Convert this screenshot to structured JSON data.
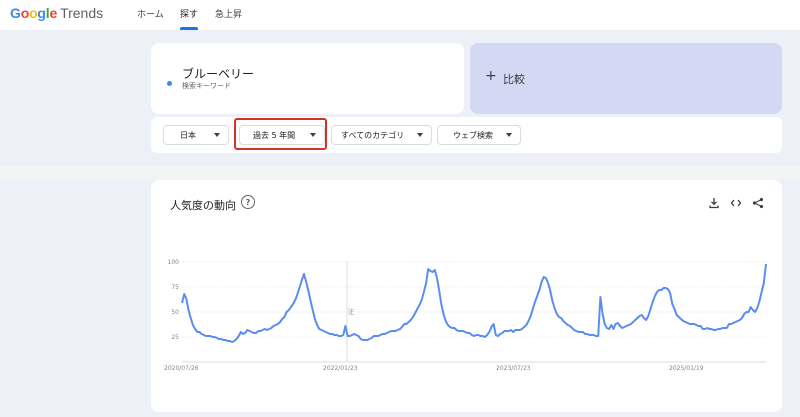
{
  "header": {
    "logo_google": "Google",
    "logo_trends": "Trends",
    "nav": [
      "ホーム",
      "探す",
      "急上昇"
    ],
    "active_nav": "探す"
  },
  "search": {
    "term": "ブルーベリー",
    "term_sublabel": "検索キーワード",
    "term_color": "#4285f4",
    "compare_label": "比較"
  },
  "filters": {
    "region": "日本",
    "period": "過去 5 年間",
    "category": "すべてのカテゴリ",
    "search_type": "ウェブ検索"
  },
  "chart_card": {
    "title": "人気度の動向",
    "help_icon": "help-icon",
    "actions": [
      "download-icon",
      "embed-code-icon",
      "share-icon"
    ]
  },
  "chart_data": {
    "type": "line",
    "title": "人気度の動向",
    "y_ticks": [
      "100",
      "75",
      "50",
      "25"
    ],
    "ylim": [
      0,
      100
    ],
    "x_tick_labels": [
      "2020/07/26",
      "2022/01/23",
      "2023/07/23",
      "2025/01/19"
    ],
    "annotation": "注",
    "line_color": "#5b8def",
    "grid": true,
    "series": [
      {
        "values": [
          59,
          68,
          63,
          52,
          44,
          37,
          33,
          30,
          30,
          28,
          27,
          26,
          26,
          26,
          25,
          25,
          24,
          23,
          23,
          22,
          22,
          21,
          21,
          20,
          21,
          23,
          26,
          30,
          28,
          29,
          32,
          31,
          30,
          29,
          29,
          31,
          31,
          32,
          33,
          32,
          33,
          34,
          36,
          37,
          38,
          40,
          43,
          45,
          50,
          52,
          55,
          58,
          62,
          68,
          75,
          82,
          88,
          80,
          71,
          61,
          52,
          43,
          37,
          33,
          32,
          31,
          30,
          29,
          28,
          28,
          27,
          27,
          26,
          26,
          27,
          36,
          26,
          26,
          27,
          28,
          27,
          26,
          23,
          22,
          22,
          22,
          23,
          24,
          26,
          26,
          26,
          27,
          28,
          28,
          29,
          30,
          31,
          31,
          31,
          32,
          33,
          35,
          38,
          38,
          40,
          42,
          45,
          49,
          53,
          57,
          62,
          70,
          79,
          93,
          91,
          90,
          92,
          84,
          72,
          58,
          48,
          41,
          37,
          35,
          34,
          34,
          32,
          31,
          31,
          31,
          30,
          29,
          29,
          27,
          26,
          27,
          27,
          26,
          26,
          25,
          27,
          30,
          35,
          38,
          27,
          26,
          28,
          29,
          31,
          31,
          31,
          32,
          30,
          32,
          32,
          32,
          33,
          35,
          37,
          41,
          46,
          53,
          60,
          66,
          72,
          80,
          85,
          84,
          79,
          71,
          61,
          54,
          48,
          45,
          44,
          41,
          39,
          37,
          36,
          34,
          32,
          31,
          30,
          30,
          30,
          28,
          28,
          27,
          27,
          27,
          26,
          26,
          65,
          48,
          38,
          34,
          33,
          37,
          33,
          38,
          39,
          36,
          34,
          35,
          36,
          37,
          38,
          40,
          42,
          44,
          46,
          47,
          44,
          42,
          46,
          53,
          60,
          66,
          70,
          72,
          72,
          74,
          74,
          73,
          69,
          58,
          53,
          47,
          45,
          43,
          41,
          40,
          39,
          38,
          38,
          38,
          37,
          36,
          36,
          33,
          33,
          34,
          33,
          33,
          32,
          32,
          33,
          33,
          34,
          34,
          34,
          38,
          38,
          39,
          40,
          41,
          42,
          44,
          48,
          50,
          50,
          55,
          52,
          50,
          54,
          61,
          70,
          79,
          98
        ]
      }
    ]
  }
}
